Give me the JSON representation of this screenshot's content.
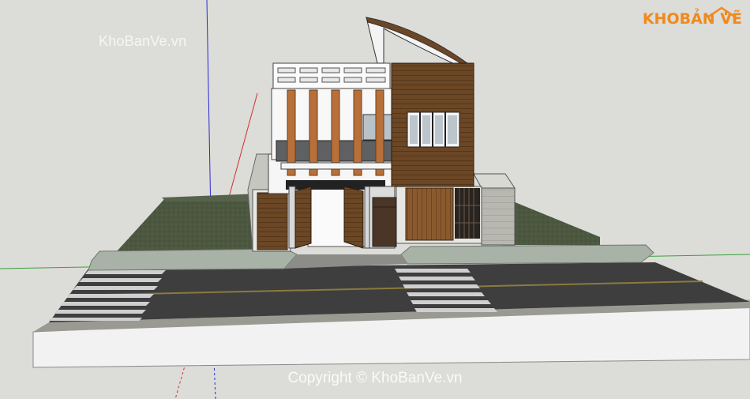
{
  "watermark_top": "KhoBanVe.vn",
  "watermark_bottom": "Copyright © KhoBanVe.vn",
  "logo": {
    "part1": "KHO",
    "part2": "BẢN VẼ"
  },
  "colors": {
    "background": "#dcdcd8",
    "grass": "#4f5a44",
    "road": "#3b3b3b",
    "wood": "#6b4726",
    "accent_orange": "#f08a1c"
  }
}
